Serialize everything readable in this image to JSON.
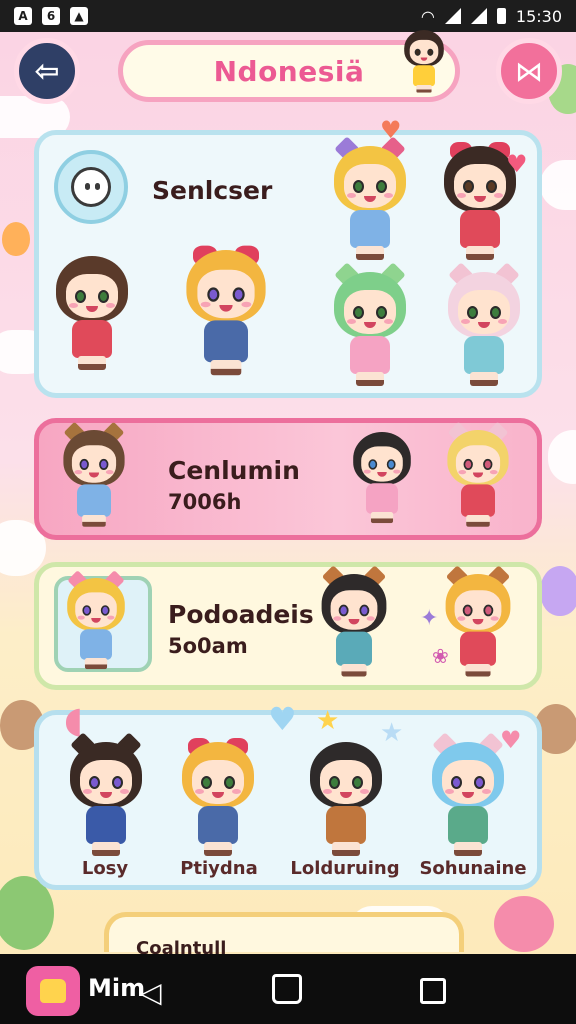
{
  "status_bar": {
    "time": "15:30",
    "left_icons": [
      "A",
      "6",
      "▲"
    ]
  },
  "header": {
    "title": "Ndonesiä",
    "back_icon": "back-arrow-icon",
    "right_icon": "bow-icon"
  },
  "cards": [
    {
      "title": "Senlcser",
      "subtitle": ""
    },
    {
      "title": "Cenlumin",
      "subtitle": "7006h"
    },
    {
      "title": "Podoadeis",
      "subtitle": "5o0am"
    }
  ],
  "characters_row": [
    {
      "name": "Losy"
    },
    {
      "name": "Ptiydna"
    },
    {
      "name": "Lolduruing"
    },
    {
      "name": "Sohunaine"
    }
  ],
  "bottom_card": {
    "title": "Coalntull"
  },
  "nav": {
    "app_label": "Mim"
  },
  "colors": {
    "accent_pink": "#ec5a93",
    "panel_blue": "#b9e2ee",
    "panel_pink": "#ec6f9c",
    "navy": "#2f3f66"
  }
}
